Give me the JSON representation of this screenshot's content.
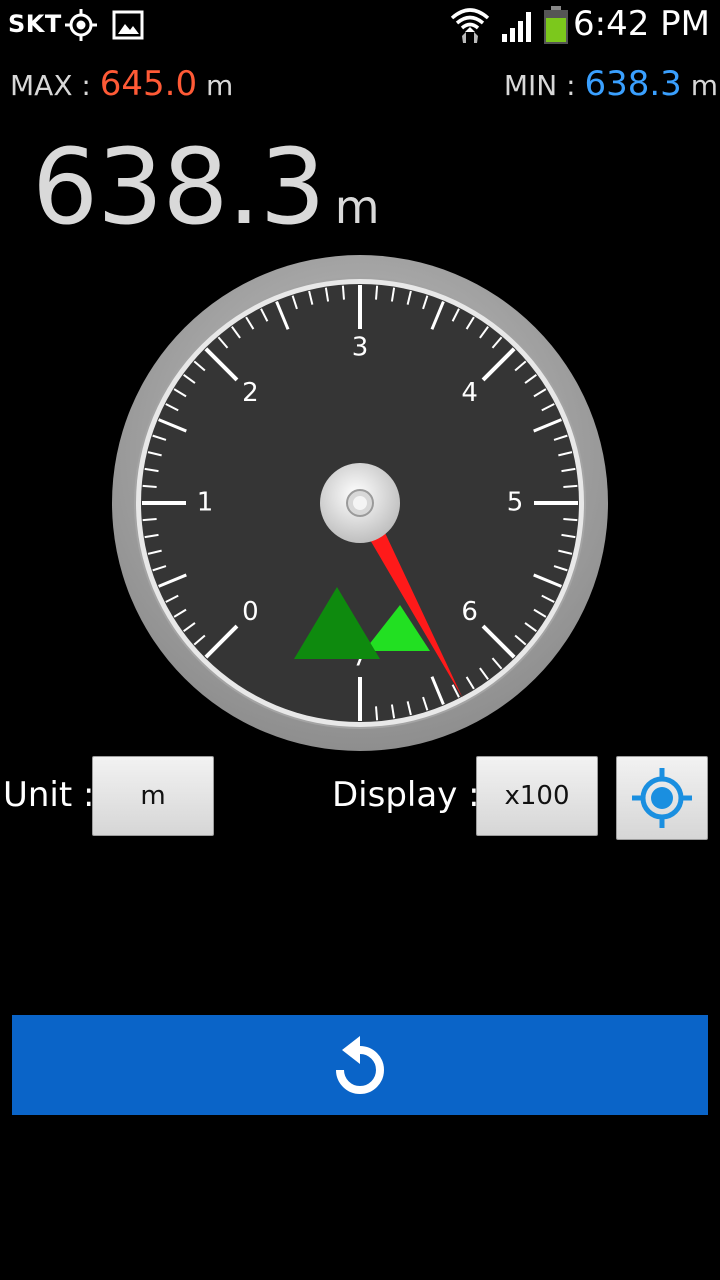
{
  "statusbar": {
    "carrier": "SKT",
    "time": "6:42 PM",
    "icons": [
      "gps-icon",
      "image-icon",
      "wifi-icon",
      "signal-icon",
      "battery-icon"
    ]
  },
  "stats": {
    "max_label": "MAX :",
    "max_value": "645.0",
    "max_unit": "m",
    "min_label": "MIN :",
    "min_value": "638.3",
    "min_unit": "m"
  },
  "current": {
    "value": "638.3",
    "unit": "m"
  },
  "gauge": {
    "scale_labels": [
      "0",
      "1",
      "2",
      "3",
      "4",
      "5",
      "6",
      "7"
    ],
    "needle_value": 6.383,
    "multiplier": 100,
    "needle_color": "#ff1a1a",
    "mountain_colors": [
      "#0e8a0e",
      "#22e022"
    ]
  },
  "controls": {
    "unit_label": "Unit :",
    "unit_value": "m",
    "display_label": "Display :",
    "display_value": "x100",
    "locate_icon_color": "#1a8fe0"
  },
  "reset": {
    "color": "#0a64c8",
    "icon": "refresh-icon"
  }
}
